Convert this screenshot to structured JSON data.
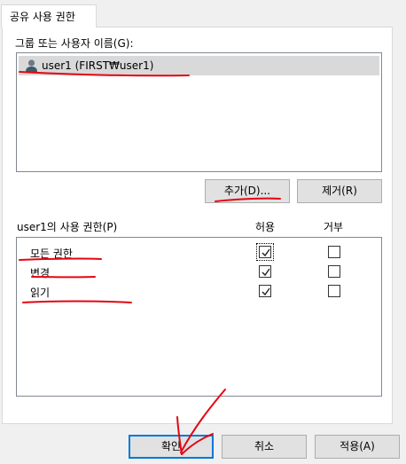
{
  "tab": {
    "label": "공유 사용 권한"
  },
  "group_label": "그룹 또는 사용자 이름(G):",
  "users": [
    {
      "label": "user1 (FIRST₩user1)",
      "selected": true
    }
  ],
  "buttons": {
    "add": "추가(D)...",
    "remove": "제거(R)"
  },
  "permissions": {
    "title": "user1의 사용 권한(P)",
    "allow_header": "허용",
    "deny_header": "거부",
    "rows": [
      {
        "name": "모든 권한",
        "allow": true,
        "deny": false
      },
      {
        "name": "변경",
        "allow": true,
        "deny": false
      },
      {
        "name": "읽기",
        "allow": true,
        "deny": false
      }
    ]
  },
  "footer": {
    "ok": "확인",
    "cancel": "취소",
    "apply": "적용(A)"
  },
  "colors": {
    "annotation": "#e30613",
    "focus_border": "#0078d7",
    "selected_row": "#d9d9d9"
  },
  "icons": {
    "user": "user-icon",
    "checkmark": "checkmark-icon"
  }
}
